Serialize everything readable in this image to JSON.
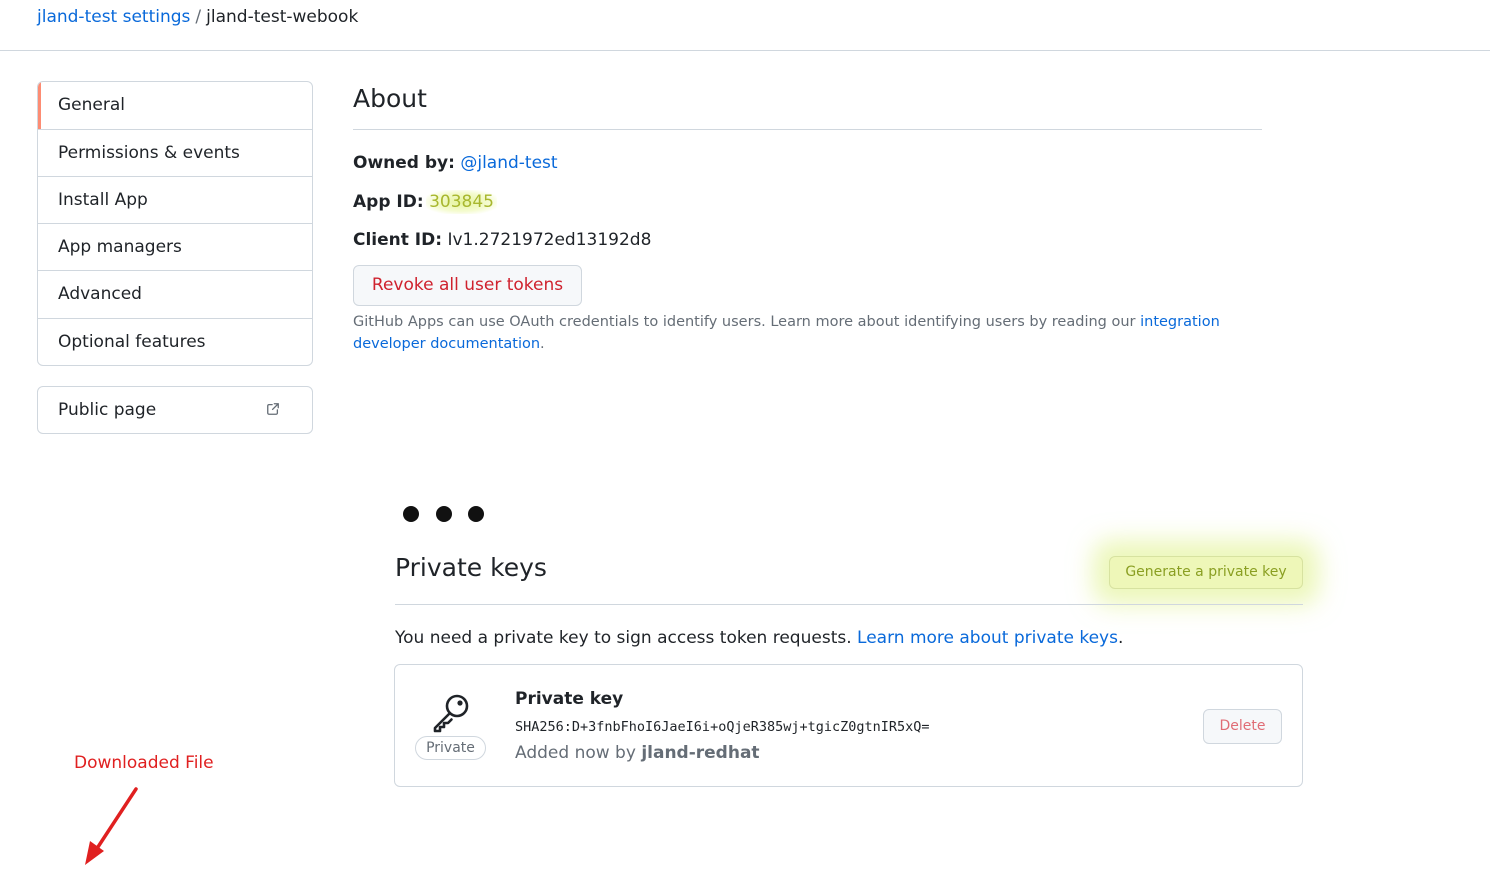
{
  "breadcrumb": {
    "parent": "jland-test settings",
    "separator": "/",
    "current": "jland-test-webook"
  },
  "sidebar": {
    "items": [
      {
        "label": "General",
        "selected": true
      },
      {
        "label": "Permissions & events"
      },
      {
        "label": "Install App"
      },
      {
        "label": "App managers"
      },
      {
        "label": "Advanced"
      },
      {
        "label": "Optional features"
      }
    ],
    "public_page": {
      "label": "Public page",
      "icon": "external-link-icon"
    }
  },
  "about": {
    "title": "About",
    "owned_by_label": "Owned by:",
    "owned_by_value": "@jland-test",
    "app_id_label": "App ID:",
    "app_id_value": "303845",
    "client_id_label": "Client ID:",
    "client_id_value": "Iv1.2721972ed13192d8",
    "revoke_button": "Revoke all user tokens",
    "note_text": "GitHub Apps can use OAuth credentials to identify users. Learn more about identifying users by reading our ",
    "note_link_1": "integration",
    "note_link_2": "developer documentation",
    "note_end": "."
  },
  "private_keys": {
    "title": "Private keys",
    "generate_button": "Generate a private key",
    "intro_text": "You need a private key to sign access token requests. ",
    "intro_link": "Learn more about private keys",
    "intro_end": ".",
    "key": {
      "icon": "key-icon",
      "badge": "Private",
      "name": "Private key",
      "hash": "SHA256:D+3fnbFhoI6JaeI6i+oQjeR385wj+tgicZ0gtnIR5xQ=",
      "added_prefix": "Added now by ",
      "added_user": "jland-redhat",
      "delete_button": "Delete"
    }
  },
  "annotation": {
    "label": "Downloaded File",
    "color": "#e02020"
  },
  "colors": {
    "link": "#0969da",
    "danger": "#cf222e",
    "highlight": "#dff28c",
    "selected_marker": "#fd8c73"
  }
}
